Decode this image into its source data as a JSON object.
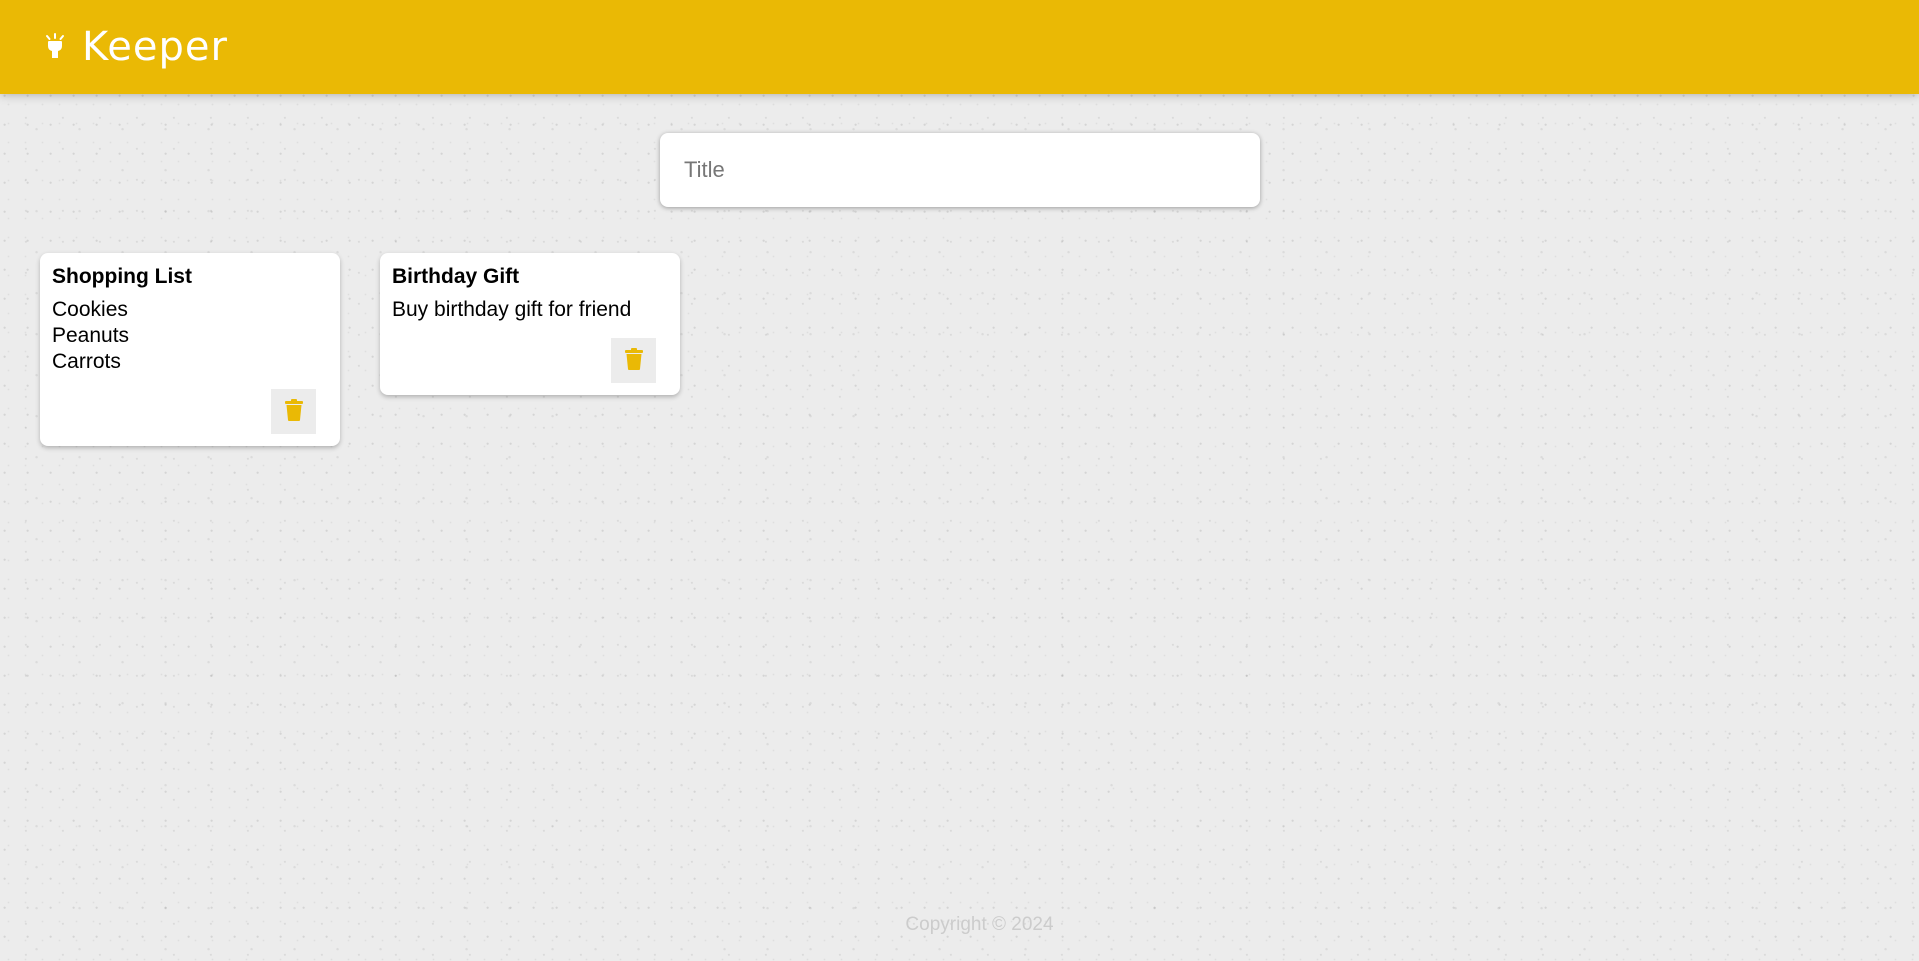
{
  "header": {
    "title": "Keeper",
    "logo_icon": "lightbulb-icon",
    "background_color": "#eab905"
  },
  "create_note": {
    "title_placeholder": "Title",
    "title_value": ""
  },
  "notes": [
    {
      "title": "Shopping List",
      "content": "Cookies\nPeanuts\nCarrots",
      "delete_icon": "trash-icon"
    },
    {
      "title": "Birthday Gift",
      "content": "Buy birthday gift for friend",
      "delete_icon": "trash-icon"
    }
  ],
  "footer": {
    "copyright": "Copyright © 2024"
  },
  "colors": {
    "accent": "#eab905",
    "page_background": "#ececec",
    "card_background": "#ffffff"
  }
}
